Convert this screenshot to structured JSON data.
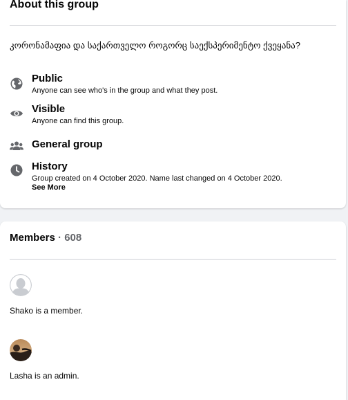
{
  "about": {
    "title": "About this group",
    "description": "კორონამაფია და საქართველო როგორც საექსპერიმენტო ქვეყანა?",
    "rows": [
      {
        "icon": "globe-icon",
        "title": "Public",
        "subtitle": "Anyone can see who's in the group and what they post."
      },
      {
        "icon": "eye-icon",
        "title": "Visible",
        "subtitle": "Anyone can find this group."
      },
      {
        "icon": "people-icon",
        "title": "General group",
        "subtitle": ""
      },
      {
        "icon": "clock-icon",
        "title": "History",
        "subtitle": "Group created on 4 October 2020. Name last changed on 4 October 2020.",
        "see_more": "See More"
      }
    ]
  },
  "members": {
    "label": "Members",
    "separator": " · ",
    "count": "608",
    "list": [
      {
        "text": "Shako is a member.",
        "avatar": "default-avatar"
      },
      {
        "text": "Lasha is an admin.",
        "avatar": "photo-avatar"
      }
    ]
  },
  "colors": {
    "background": "#f0f2f5",
    "card": "#ffffff",
    "icon": "#65676b",
    "divider": "#ced0d4",
    "secondary_text": "#65676b"
  }
}
